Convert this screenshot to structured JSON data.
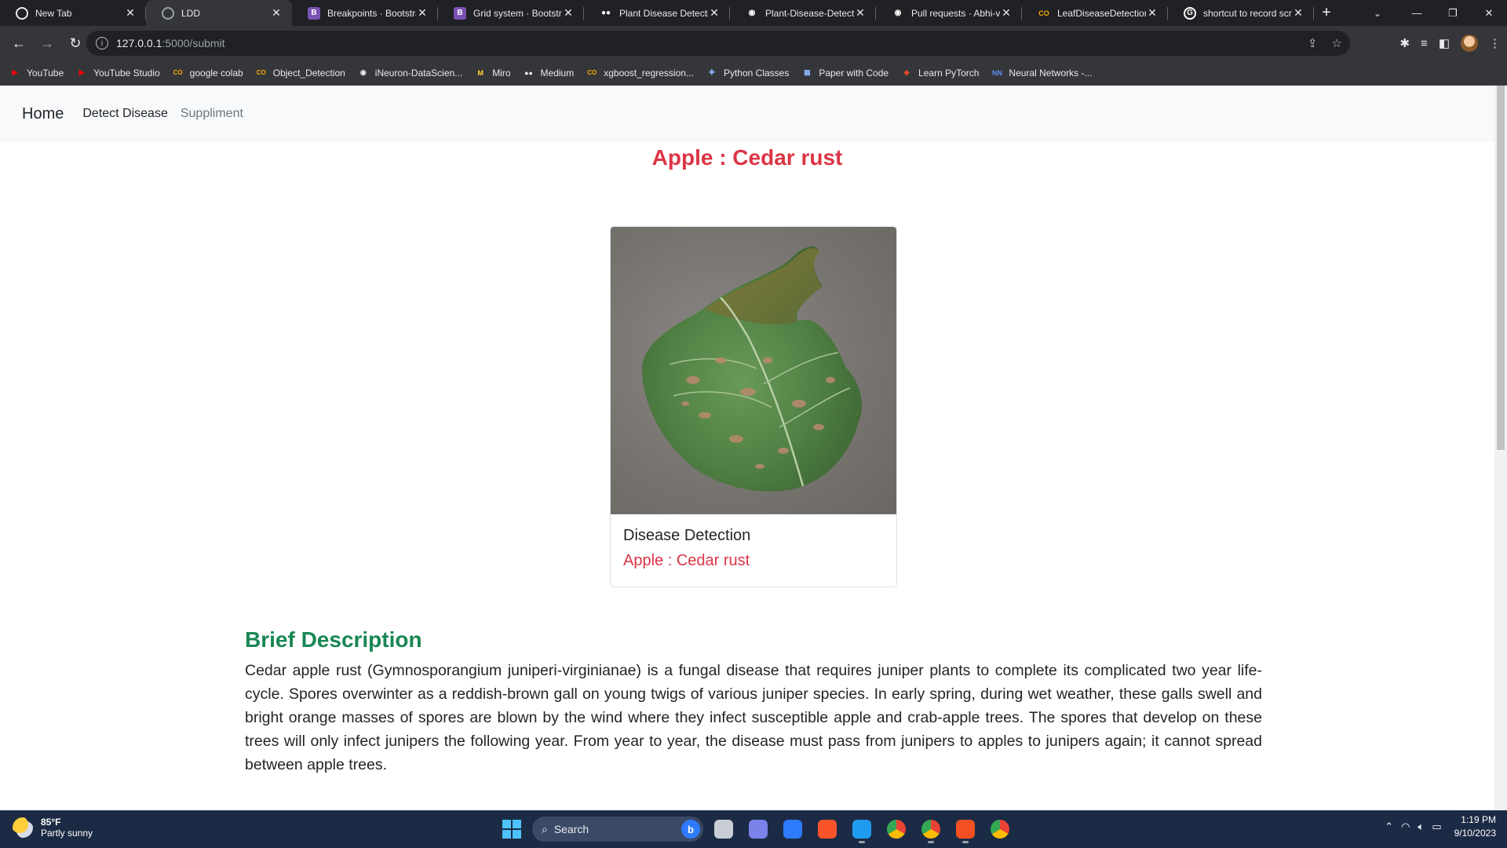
{
  "browser": {
    "tabs": [
      {
        "title": "New Tab",
        "icon": "chrome-icon",
        "color": "#e8eaed",
        "glyph": "",
        "active": false
      },
      {
        "title": "LDD",
        "icon": "globe-icon",
        "color": "#9aa0a6",
        "glyph": "",
        "active": true
      },
      {
        "title": "Breakpoints · Bootstrap",
        "icon": "bootstrap-icon",
        "color": "#7952b3",
        "glyph": "B",
        "active": false
      },
      {
        "title": "Grid system · Bootstrap",
        "icon": "bootstrap-icon",
        "color": "#7952b3",
        "glyph": "B",
        "active": false
      },
      {
        "title": "Plant Disease Detection",
        "icon": "medium-icon",
        "color": "#202124",
        "glyph": "●●",
        "active": false
      },
      {
        "title": "Plant-Disease-Detection",
        "icon": "github-icon",
        "color": "#202124",
        "glyph": "◉",
        "active": false
      },
      {
        "title": "Pull requests · Abhi-vi",
        "icon": "github-icon",
        "color": "#202124",
        "glyph": "◉",
        "active": false
      },
      {
        "title": "LeafDiseaseDetection",
        "icon": "colab-icon",
        "color": "#202124",
        "glyph": "CO",
        "active": false
      },
      {
        "title": "shortcut to record screen",
        "icon": "google-icon",
        "color": "#ffffff",
        "glyph": "G",
        "active": false
      }
    ],
    "url_host": "127.0.0.1",
    "url_path": ":5000/submit",
    "bookmarks": [
      {
        "label": "YouTube",
        "icon": "youtube-icon",
        "color": "#ff0000",
        "glyph": "▶"
      },
      {
        "label": "YouTube Studio",
        "icon": "youtube-studio-icon",
        "color": "#ff0000",
        "glyph": "▶"
      },
      {
        "label": "google colab",
        "icon": "colab-icon",
        "color": "#f9ab00",
        "glyph": "CO"
      },
      {
        "label": "Object_Detection",
        "icon": "colab-icon",
        "color": "#f9ab00",
        "glyph": "CO"
      },
      {
        "label": "iNeuron-DataScien...",
        "icon": "github-icon",
        "color": "#e8eaed",
        "glyph": "◉"
      },
      {
        "label": "Miro",
        "icon": "miro-icon",
        "color": "#ffd02f",
        "glyph": "M"
      },
      {
        "label": "Medium",
        "icon": "medium-icon",
        "color": "#e8eaed",
        "glyph": "●●"
      },
      {
        "label": "xgboost_regression...",
        "icon": "colab-icon",
        "color": "#f9ab00",
        "glyph": "CO"
      },
      {
        "label": "Python Classes",
        "icon": "python-icon",
        "color": "#8ab4f8",
        "glyph": "✚"
      },
      {
        "label": "Paper with Code",
        "icon": "paperswithcode-icon",
        "color": "#8ab4f8",
        "glyph": "▦"
      },
      {
        "label": "Learn PyTorch",
        "icon": "pytorch-icon",
        "color": "#ee4c2c",
        "glyph": "◈"
      },
      {
        "label": "Neural Networks -...",
        "icon": "neural-networks-icon",
        "color": "#5b8def",
        "glyph": "NN"
      }
    ]
  },
  "page": {
    "nav": {
      "brand": "Home",
      "links": [
        "Detect Disease",
        "Suppliment"
      ]
    },
    "result_title": "Apple : Cedar rust",
    "card": {
      "title": "Disease Detection",
      "result": "Apple : Cedar rust"
    },
    "description": {
      "heading": "Brief Description",
      "text": "Cedar apple rust (Gymnosporangium juniperi-virginianae) is a fungal disease that requires juniper plants to complete its complicated two year life-cycle. Spores overwinter as a reddish-brown gall on young twigs of various juniper species. In early spring, during wet weather, these galls swell and bright orange masses of spores are blown by the wind where they infect susceptible apple and crab-apple trees. The spores that develop on these trees will only infect junipers the following year. From year to year, the disease must pass from junipers to apples to junipers again; it cannot spread between apple trees."
    },
    "colors": {
      "danger": "#dc3545",
      "success": "#198754"
    }
  },
  "taskbar": {
    "weather_temp": "85°F",
    "weather_desc": "Partly sunny",
    "search_placeholder": "Search",
    "apps": [
      {
        "icon": "file-explorer-icon",
        "color": "#c9ced6",
        "state": ""
      },
      {
        "icon": "teams-icon",
        "color": "#7b83eb",
        "state": ""
      },
      {
        "icon": "store-icon",
        "color": "#2f7bff",
        "state": ""
      },
      {
        "icon": "brave-icon",
        "color": "#fb542b",
        "state": ""
      },
      {
        "icon": "vscode-icon",
        "color": "#1f9cf0",
        "state": "run"
      },
      {
        "icon": "chrome-icon",
        "color": "#34a853",
        "state": "act"
      },
      {
        "icon": "chrome-profile-icon",
        "color": "#fbbc05",
        "state": "run"
      },
      {
        "icon": "microsoft-store-icon",
        "color": "#f25022",
        "state": "run"
      },
      {
        "icon": "chrome-canary-icon",
        "color": "#ea4335",
        "state": ""
      }
    ],
    "time": "1:19 PM",
    "date": "9/10/2023"
  }
}
